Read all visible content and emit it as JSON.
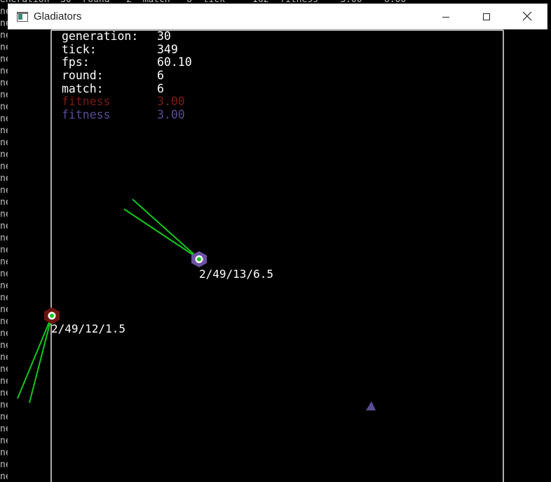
{
  "console": {
    "top_line": "eneration  30  round   2  match   6  tick     162  fitness    3.00    6.00",
    "row_prefix": "ne",
    "row_count": 40
  },
  "window": {
    "title": "Gladiators",
    "icons": {
      "app": "app-window-icon",
      "minimize": "minimize-icon",
      "maximize": "maximize-icon",
      "close": "close-icon"
    }
  },
  "hud": {
    "rows": [
      {
        "label": "generation:",
        "value": "30",
        "color": "#ffffff"
      },
      {
        "label": "tick:",
        "value": "349",
        "color": "#ffffff"
      },
      {
        "label": "fps:",
        "value": "60.10",
        "color": "#ffffff"
      },
      {
        "label": "round:",
        "value": "6",
        "color": "#ffffff"
      },
      {
        "label": "match:",
        "value": "6",
        "color": "#ffffff"
      },
      {
        "label": "fitness",
        "value": "3.00",
        "color": "#7a1a12"
      },
      {
        "label": "fitness",
        "value": "3.00",
        "color": "#5a4c94"
      }
    ]
  },
  "gladiators": [
    {
      "label": "2/49/13/6.5",
      "color": "#6b53a2"
    },
    {
      "label": "2/49/12/1.5",
      "color": "#7a1a12"
    }
  ],
  "projectile": {
    "color": "#6b53a2"
  },
  "colors": {
    "sensor": "#12c81a",
    "core": "#12c81a",
    "text": "#ffffff",
    "border": "#e6e6e6"
  }
}
